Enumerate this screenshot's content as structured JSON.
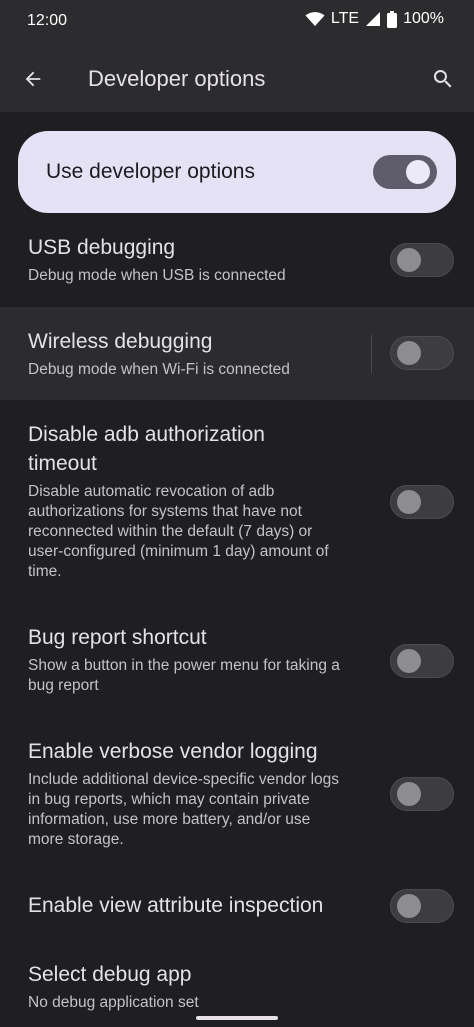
{
  "status": {
    "time": "12:00",
    "network": "LTE",
    "battery": "100%"
  },
  "app_bar": {
    "title": "Developer options",
    "back_icon": "arrow-back-icon",
    "search_icon": "search-icon"
  },
  "master_switch": {
    "label": "Use developer options",
    "on": true
  },
  "settings": [
    {
      "title": "USB debugging",
      "subtitle": "Debug mode when USB is connected",
      "on": false
    },
    {
      "title": "Wireless debugging",
      "subtitle": "Debug mode when Wi-Fi is connected",
      "on": false
    },
    {
      "title_lines": [
        "Disable adb authorization",
        "timeout"
      ],
      "subtitle_lines": [
        "Disable automatic revocation of adb",
        "authorizations for systems that have not",
        "reconnected within the default (7 days) or",
        "user-configured (minimum 1 day) amount of",
        "time."
      ],
      "on": false
    },
    {
      "title": "Bug report shortcut",
      "subtitle_lines": [
        "Show a button in the power menu for taking a",
        "bug report"
      ],
      "on": false
    },
    {
      "title": "Enable verbose vendor logging",
      "subtitle_lines": [
        "Include additional device-specific vendor logs",
        "in bug reports, which may contain private",
        "information, use more battery, and/or use",
        "more storage."
      ],
      "on": false
    },
    {
      "title": "Enable view attribute inspection",
      "on": false
    },
    {
      "title": "Select debug app",
      "subtitle": "No debug application set"
    }
  ],
  "colors": {
    "background": "#1f1f21",
    "app_bar": "#2c2c2e",
    "master_card": "#e5e2f5",
    "toggle_on_track": "#5f5d6b",
    "toggle_off_track": "#3d3d40"
  }
}
